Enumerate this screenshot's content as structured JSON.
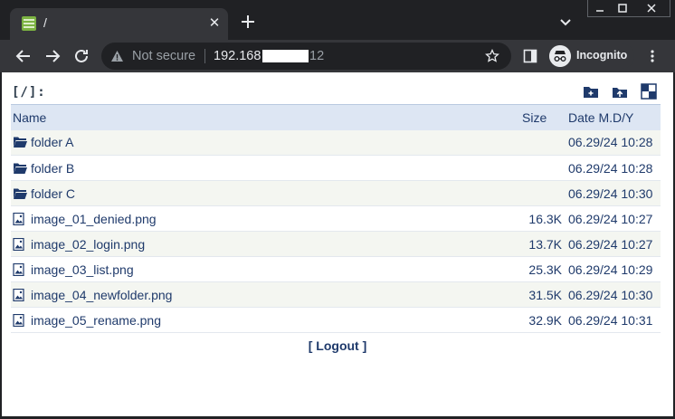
{
  "browser": {
    "tab_title": "/",
    "tab_close": "✕",
    "address": {
      "security_text": "Not secure",
      "host_visible": "192.168",
      "host_tail": "12"
    },
    "incognito_label": "Incognito"
  },
  "page": {
    "path": "[/]:",
    "columns": {
      "name": "Name",
      "size": "Size",
      "date": "Date M.D/Y"
    },
    "rows": [
      {
        "name": "folder A",
        "size": "",
        "date": "06.29/24 10:28",
        "type": "folder"
      },
      {
        "name": "folder B",
        "size": "",
        "date": "06.29/24 10:28",
        "type": "folder"
      },
      {
        "name": "folder C",
        "size": "",
        "date": "06.29/24 10:30",
        "type": "folder"
      },
      {
        "name": "image_01_denied.png",
        "size": "16.3K",
        "date": "06.29/24 10:27",
        "type": "image"
      },
      {
        "name": "image_02_login.png",
        "size": "13.7K",
        "date": "06.29/24 10:27",
        "type": "image"
      },
      {
        "name": "image_03_list.png",
        "size": "25.3K",
        "date": "06.29/24 10:29",
        "type": "image"
      },
      {
        "name": "image_04_newfolder.png",
        "size": "31.5K",
        "date": "06.29/24 10:30",
        "type": "image"
      },
      {
        "name": "image_05_rename.png",
        "size": "32.9K",
        "date": "06.29/24 10:31",
        "type": "image"
      }
    ],
    "logout_label": "[ Logout ]"
  },
  "colors": {
    "chrome_dark": "#202124",
    "chrome_toolbar": "#35363a",
    "link_text": "#1f3a6b",
    "header_bg": "#dde6f3",
    "stripe_bg": "#f4f6f1"
  },
  "icons": {
    "folder_row": "folder-icon",
    "image_row": "image-file-icon",
    "actions": [
      "new-folder-icon",
      "upload-icon",
      "select-toggle-icon"
    ]
  }
}
